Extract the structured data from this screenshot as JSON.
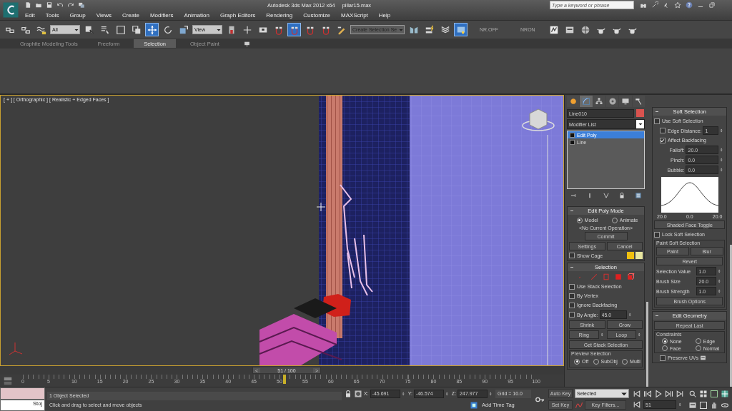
{
  "title_bar": {
    "app_title": "Autodesk 3ds Max 2012 x64",
    "file_name": "pillar15.max",
    "search_placeholder": "Type a keyword or phrase"
  },
  "menu": [
    "Edit",
    "Tools",
    "Group",
    "Views",
    "Create",
    "Modifiers",
    "Animation",
    "Graph Editors",
    "Rendering",
    "Customize",
    "MAXScript",
    "Help"
  ],
  "toolbar": [
    {
      "kind": "tool",
      "active": false
    },
    {
      "kind": "tool",
      "active": false
    },
    {
      "kind": "tool",
      "active": false
    },
    {
      "kind": "dropdown",
      "value": "All"
    },
    {
      "kind": "tool",
      "active": false
    },
    {
      "kind": "tool",
      "active": false
    },
    {
      "kind": "tool",
      "active": false
    },
    {
      "kind": "tool",
      "active": false
    },
    {
      "kind": "tool",
      "active": true
    },
    {
      "kind": "tool",
      "active": false
    },
    {
      "kind": "tool",
      "active": false
    },
    {
      "kind": "dropdown",
      "value": "View"
    },
    {
      "kind": "tool",
      "active": false
    },
    {
      "kind": "tool",
      "active": false
    },
    {
      "kind": "tool",
      "active": false
    },
    {
      "kind": "tool",
      "active": false
    },
    {
      "kind": "tool",
      "active": true
    },
    {
      "kind": "tool",
      "active": false
    },
    {
      "kind": "tool",
      "active": false
    },
    {
      "kind": "tool",
      "active": false
    },
    {
      "kind": "dropdown",
      "value": "Create Selection Se"
    },
    {
      "kind": "tool",
      "active": false
    },
    {
      "kind": "tool",
      "active": false
    },
    {
      "kind": "tool",
      "active": false
    },
    {
      "kind": "tool",
      "active": true
    },
    {
      "kind": "label",
      "text": "NR.OFF"
    },
    {
      "kind": "label",
      "text": "NRON"
    },
    {
      "kind": "tool",
      "active": false
    },
    {
      "kind": "tool",
      "active": false
    },
    {
      "kind": "tool",
      "active": false
    },
    {
      "kind": "tool",
      "active": false
    },
    {
      "kind": "tool",
      "active": false
    },
    {
      "kind": "tool",
      "active": false
    }
  ],
  "ribbon_tabs": [
    {
      "label": "Graphite Modeling Tools",
      "selected": false
    },
    {
      "label": "Freeform",
      "selected": false
    },
    {
      "label": "Selection",
      "selected": true
    },
    {
      "label": "Object Paint",
      "selected": false
    }
  ],
  "viewport": {
    "label": "[ + ] [ Orthographic ] [ Realistic + Edged Faces ]",
    "active": true
  },
  "time_slider": {
    "position": "51 / 100",
    "prev": "<",
    "next": ">"
  },
  "time_ruler": {
    "ticks": [
      "0",
      "5",
      "10",
      "15",
      "20",
      "25",
      "30",
      "35",
      "40",
      "45",
      "50",
      "55",
      "60",
      "65",
      "70",
      "75",
      "80",
      "85",
      "90",
      "95",
      "100"
    ]
  },
  "command_panel": {
    "tabs": [
      {
        "selected": false
      },
      {
        "selected": true
      },
      {
        "selected": false
      },
      {
        "selected": false
      },
      {
        "selected": false
      },
      {
        "selected": false
      }
    ],
    "object_name": "Line010",
    "modifier_list": "Modifier List",
    "stack": [
      {
        "label": "Edit Poly",
        "selected": true
      },
      {
        "label": "Line",
        "selected": false
      }
    ],
    "edit_poly_mode": {
      "title": "Edit Poly Mode",
      "modes": [
        {
          "label": "Model",
          "selected": true
        },
        {
          "label": "Animate",
          "selected": false
        }
      ],
      "operation": "<No Current Operation>",
      "commit": "Commit",
      "settings": "Settings",
      "cancel": "Cancel",
      "show_cage": {
        "label": "Show Cage",
        "checked": false
      }
    },
    "selection": {
      "title": "Selection",
      "options": [
        {
          "label": "Use Stack Selection",
          "checked": false
        },
        {
          "label": "By Vertex",
          "checked": false
        },
        {
          "label": "Ignore Backfacing",
          "checked": false
        }
      ],
      "by_angle": {
        "label": "By Angle:",
        "checked": false,
        "value": "45.0"
      },
      "shrink": "Shrink",
      "grow": "Grow",
      "ring": "Ring",
      "loop": "Loop",
      "get_stack": "Get Stack Selection",
      "preview": {
        "title": "Preview Selection",
        "options": [
          {
            "label": "Off",
            "selected": true
          },
          {
            "label": "SubObj",
            "selected": false
          },
          {
            "label": "Multi",
            "selected": false
          }
        ]
      }
    },
    "soft_selection": {
      "title": "Soft Selection",
      "use": {
        "label": "Use Soft Selection",
        "checked": false
      },
      "edge_distance": {
        "label": "Edge Distance:",
        "checked": false,
        "value": "1"
      },
      "affect_backfacing": {
        "label": "Affect Backfacing",
        "checked": true
      },
      "params": [
        {
          "label": "Falloff:",
          "value": "20.0"
        },
        {
          "label": "Pinch:",
          "value": "0.0"
        },
        {
          "label": "Bubble:",
          "value": "0.0"
        }
      ],
      "curve_labels": [
        "20.0",
        "0.0",
        "20.0"
      ],
      "shaded_face_toggle": "Shaded Face Toggle",
      "lock": {
        "label": "Lock Soft Selection",
        "checked": false
      },
      "paint_group": {
        "title": "Paint Soft Selection",
        "paint": "Paint",
        "blur": "Blur",
        "revert": "Revert",
        "params": [
          {
            "label": "Selection Value",
            "value": "1.0"
          },
          {
            "label": "Brush Size",
            "value": "20.0"
          },
          {
            "label": "Brush Strength",
            "value": "1.0"
          }
        ],
        "brush_options": "Brush Options"
      }
    },
    "edit_geometry": {
      "title": "Edit Geometry",
      "repeat_last": "Repeat Last",
      "constraints": {
        "title": "Constraints",
        "options": [
          {
            "label": "None",
            "selected": true
          },
          {
            "label": "Edge",
            "selected": false
          },
          {
            "label": "Face",
            "selected": false
          },
          {
            "label": "Normal",
            "selected": false
          }
        ]
      },
      "preserve_uvs": {
        "label": "Preserve UVs",
        "checked": false
      }
    }
  },
  "status_bar": {
    "listener_text": "Stoj",
    "selection_count": "1 Object Selected",
    "prompt": "Click and drag to select and move objects",
    "coords": [
      {
        "axis": "X:",
        "value": "-45.691"
      },
      {
        "axis": "Y:",
        "value": "-46.574"
      },
      {
        "axis": "Z:",
        "value": "247.977"
      }
    ],
    "grid": "Grid = 10.0",
    "add_time_tag": "Add Time Tag",
    "auto_key": "Auto Key",
    "set_key": "Set Key",
    "key_mode": "Selected",
    "key_filters": "Key Filters...",
    "frame": "51"
  }
}
